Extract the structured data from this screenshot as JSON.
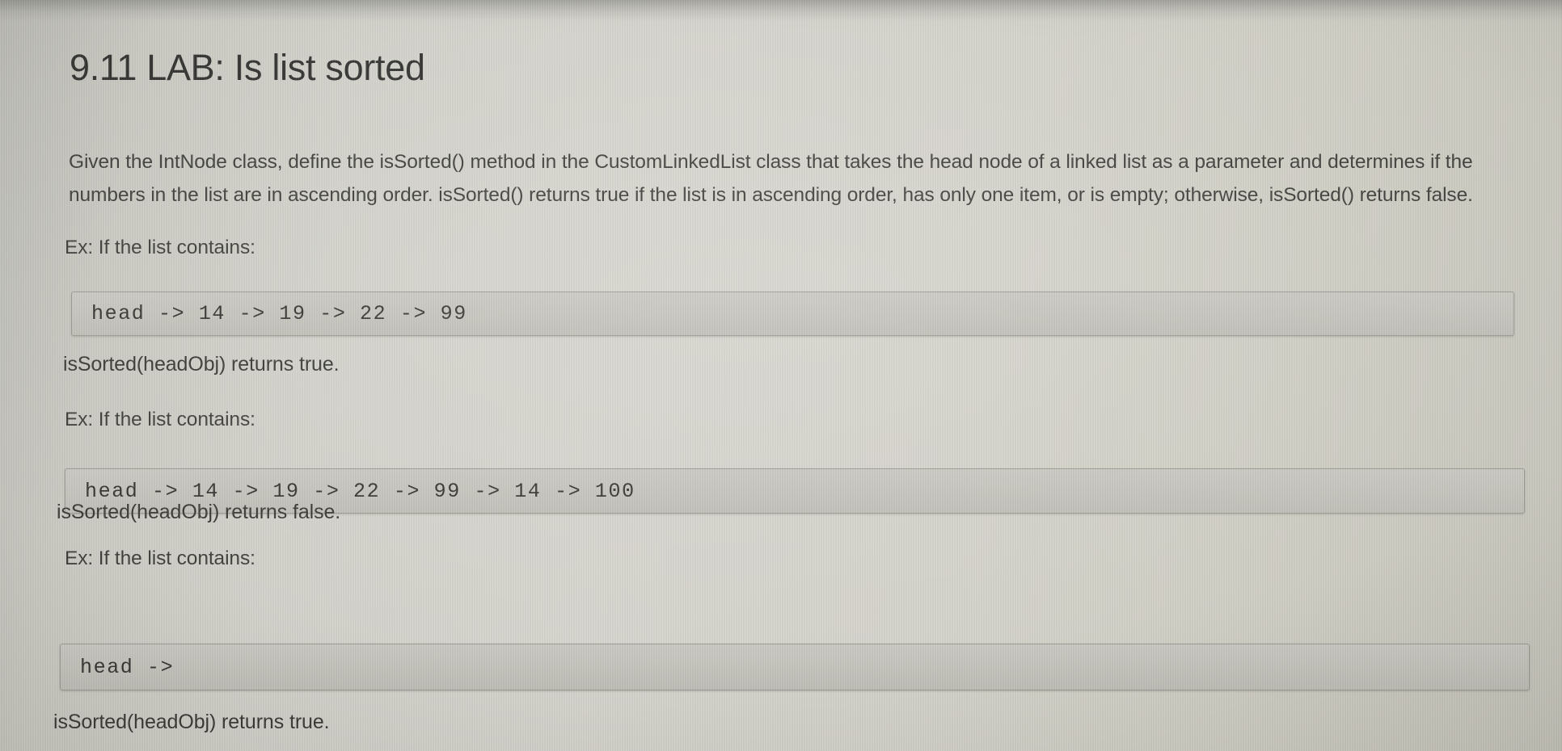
{
  "page": {
    "title": "9.11 LAB: Is list sorted",
    "intro_paragraph": "Given the IntNode class, define the isSorted() method in the CustomLinkedList class that takes the head node of a linked list as a parameter and determines if the numbers in the list are in ascending order. isSorted() returns true if the list is in ascending order, has only one item, or is empty; otherwise, isSorted() returns false."
  },
  "examples": [
    {
      "label": "Ex: If the list contains:",
      "code": "head -> 14 -> 19 -> 22 -> 99",
      "result": "isSorted(headObj) returns true."
    },
    {
      "label": "Ex: If the list contains:",
      "code": "head -> 14 -> 19 -> 22 -> 99 -> 14 -> 100",
      "result": "isSorted(headObj) returns false."
    },
    {
      "label": "Ex: If the list contains:",
      "code": "head ->",
      "result": "isSorted(headObj) returns true."
    }
  ],
  "colors": {
    "background": "#d2d2ca",
    "text": "#3a3a36",
    "title": "#2e2e2c",
    "code_background": "#c4c3bb",
    "code_border": "#9b9a92"
  }
}
